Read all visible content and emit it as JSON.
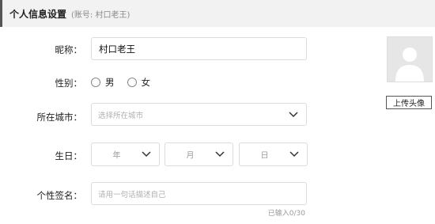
{
  "header": {
    "title": "个人信息设置",
    "account": "(账号: 村口老王)"
  },
  "form": {
    "nickname": {
      "label": "昵称：",
      "value": "村口老王"
    },
    "gender": {
      "label": "性别：",
      "options": [
        "男",
        "女"
      ]
    },
    "city": {
      "label": "所在城市：",
      "placeholder": "选择所在城市"
    },
    "birthday": {
      "label": "生日：",
      "year": "年",
      "month": "月",
      "day": "日"
    },
    "signature": {
      "label": "个性签名：",
      "placeholder": "请用一句话描述自己",
      "counter": "已输入0/30"
    }
  },
  "avatar": {
    "upload_label": "上传头像"
  },
  "icons": [
    "chevron-down-icon",
    "avatar-placeholder-icon"
  ]
}
